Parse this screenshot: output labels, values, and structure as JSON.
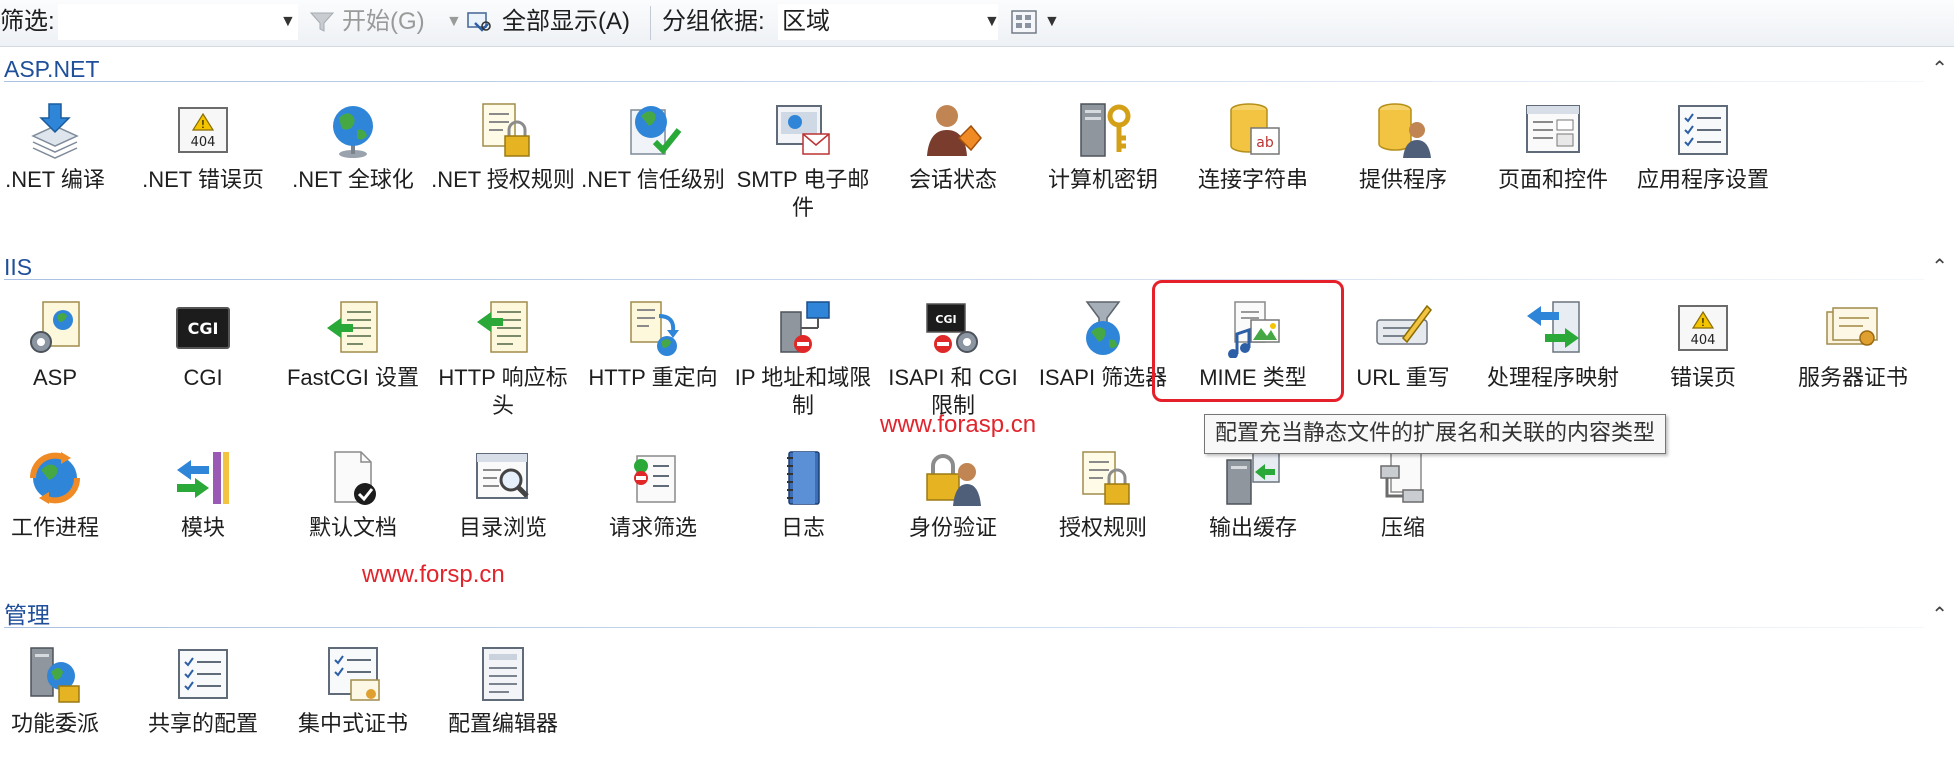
{
  "toolbar": {
    "filter_label": "筛选:",
    "start_label": "开始(G)",
    "show_all_label": "全部显示(A)",
    "group_by_label": "分组依据:",
    "group_by_value": "区域"
  },
  "sections": {
    "aspnet": {
      "title": "ASP.NET",
      "items": [
        {
          "label": ".NET 编译",
          "icon": "net-compile-icon"
        },
        {
          "label": ".NET 错误页",
          "icon": "net-error-page-icon"
        },
        {
          "label": ".NET 全球化",
          "icon": "globe-icon"
        },
        {
          "label": ".NET 授权规则",
          "icon": "net-authorization-rules-icon"
        },
        {
          "label": ".NET 信任级别",
          "icon": "net-trust-levels-icon"
        },
        {
          "label": "SMTP 电子邮件",
          "icon": "smtp-email-icon"
        },
        {
          "label": "会话状态",
          "icon": "session-state-icon"
        },
        {
          "label": "计算机密钥",
          "icon": "machine-key-icon"
        },
        {
          "label": "连接字符串",
          "icon": "connection-strings-icon"
        },
        {
          "label": "提供程序",
          "icon": "providers-icon"
        },
        {
          "label": "页面和控件",
          "icon": "pages-controls-icon"
        },
        {
          "label": "应用程序设置",
          "icon": "application-settings-icon"
        }
      ]
    },
    "iis": {
      "title": "IIS",
      "items": [
        {
          "label": "ASP",
          "icon": "asp-icon"
        },
        {
          "label": "CGI",
          "icon": "cgi-icon"
        },
        {
          "label": "FastCGI 设置",
          "icon": "fastcgi-settings-icon"
        },
        {
          "label": "HTTP 响应标头",
          "icon": "http-response-headers-icon"
        },
        {
          "label": "HTTP 重定向",
          "icon": "http-redirect-icon"
        },
        {
          "label": "IP 地址和域限制",
          "icon": "ip-domain-restrictions-icon"
        },
        {
          "label": "ISAPI 和 CGI 限制",
          "icon": "isapi-cgi-restrictions-icon"
        },
        {
          "label": "ISAPI 筛选器",
          "icon": "isapi-filters-icon"
        },
        {
          "label": "MIME 类型",
          "icon": "mime-types-icon"
        },
        {
          "label": "URL 重写",
          "icon": "url-rewrite-icon"
        },
        {
          "label": "处理程序映射",
          "icon": "handler-mappings-icon"
        },
        {
          "label": "错误页",
          "icon": "error-pages-icon"
        },
        {
          "label": "服务器证书",
          "icon": "server-certificates-icon"
        },
        {
          "label": "工作进程",
          "icon": "worker-processes-icon"
        },
        {
          "label": "模块",
          "icon": "modules-icon"
        },
        {
          "label": "默认文档",
          "icon": "default-document-icon"
        },
        {
          "label": "目录浏览",
          "icon": "directory-browsing-icon"
        },
        {
          "label": "请求筛选",
          "icon": "request-filtering-icon"
        },
        {
          "label": "日志",
          "icon": "logging-icon"
        },
        {
          "label": "身份验证",
          "icon": "authentication-icon"
        },
        {
          "label": "授权规则",
          "icon": "authorization-rules-icon"
        },
        {
          "label": "输出缓存",
          "icon": "output-caching-icon"
        },
        {
          "label": "压缩",
          "icon": "compression-icon"
        }
      ]
    },
    "management": {
      "title": "管理",
      "items": [
        {
          "label": "功能委派",
          "icon": "feature-delegation-icon"
        },
        {
          "label": "共享的配置",
          "icon": "shared-configuration-icon"
        },
        {
          "label": "集中式证书",
          "icon": "centralized-certificates-icon"
        },
        {
          "label": "配置编辑器",
          "icon": "configuration-editor-icon"
        }
      ]
    }
  },
  "tooltip": "配置充当静态文件的扩展名和关联的内容类型",
  "watermarks": [
    "www.forasp.cn",
    "www.forsp.cn"
  ],
  "colors": {
    "section_title": "#1f4e9a",
    "highlight": "#e5202a",
    "watermark": "#e1252d"
  }
}
